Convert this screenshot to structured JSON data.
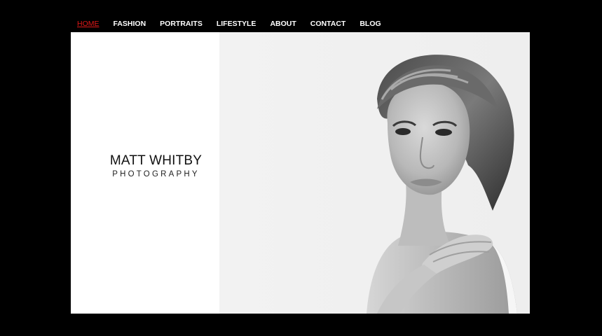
{
  "nav": {
    "items": [
      {
        "label": "HOME",
        "active": true
      },
      {
        "label": "FASHION",
        "active": false
      },
      {
        "label": "PORTRAITS",
        "active": false
      },
      {
        "label": "LIFESTYLE",
        "active": false
      },
      {
        "label": "ABOUT",
        "active": false
      },
      {
        "label": "CONTACT",
        "active": false
      },
      {
        "label": "BLOG",
        "active": false
      }
    ]
  },
  "brand": {
    "name": "MATT WHITBY",
    "subtitle": "PHOTOGRAPHY"
  },
  "colors": {
    "background": "#000000",
    "active_nav": "#e01818",
    "nav_text": "#ffffff",
    "panel": "#ffffff"
  }
}
